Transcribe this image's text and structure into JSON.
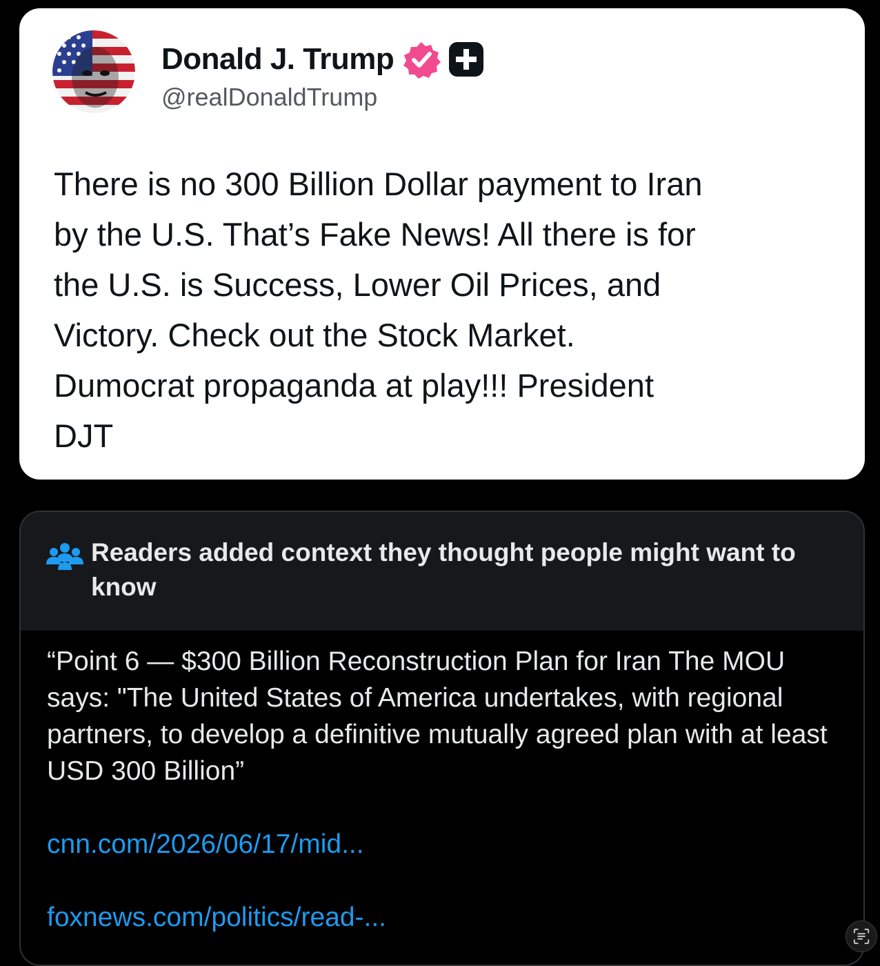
{
  "post": {
    "author": {
      "display_name": "Donald J. Trump",
      "handle": "@realDonaldTrump",
      "avatar_icon": "flag-face-avatar",
      "verified_icon": "verified-badge-icon",
      "verified_color": "#f04b8e",
      "plus_badge_icon": "plus-badge-icon"
    },
    "text": "There is no 300 Billion Dollar payment to Iran\nby the U.S. That’s Fake News! All there is for\nthe U.S. is Success, Lower Oil Prices, and\nVictory. Check out the Stock Market.\nDumocrat propaganda at play!!! President\nDJT"
  },
  "community_note": {
    "header_icon": "readers-group-icon",
    "title": "Readers added context they thought people might want to know",
    "text": "“Point 6 — $300 Billion Reconstruction Plan for Iran The MOU says:  \"The United States of America undertakes, with regional partners, to develop a definitive mutually agreed plan with at least USD 300 Billion”",
    "links": [
      "cnn.com/2026/06/17/mid...",
      "foxnews.com/politics/read-..."
    ],
    "link_color": "#1d9bf0"
  },
  "overlay": {
    "scan_icon": "text-scan-icon"
  }
}
